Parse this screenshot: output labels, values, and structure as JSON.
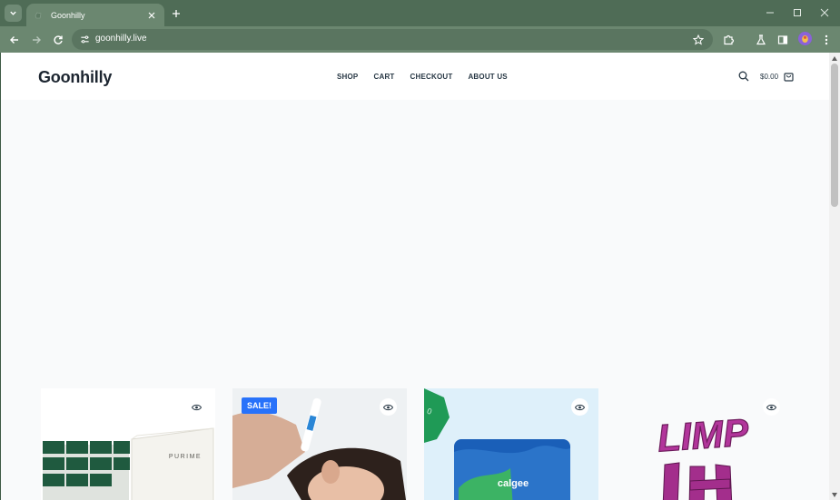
{
  "browser": {
    "tab_title": "Goonhilly",
    "url": "goonhilly.live",
    "icons": [
      "tab-search-icon",
      "favicon",
      "close-icon",
      "plus-icon",
      "minimize-icon",
      "maximize-icon",
      "close-window-icon",
      "back-icon",
      "forward-icon",
      "reload-icon",
      "site-info-icon",
      "star-icon",
      "extensions-icon",
      "labs-icon",
      "side-panel-icon",
      "profile-icon",
      "menu-icon"
    ]
  },
  "site": {
    "logo": "Goonhilly",
    "nav": [
      "SHOP",
      "CART",
      "CHECKOUT",
      "ABOUT US"
    ],
    "cart_total": "$0.00",
    "icons": [
      "search-icon",
      "cart-icon"
    ]
  },
  "products": [
    {
      "image": "purime-product",
      "badge": "",
      "brand_text": "PURIME"
    },
    {
      "image": "ear-cleaning",
      "badge": "SALE!",
      "brand_text": ""
    },
    {
      "image": "calgee-bag",
      "badge": "",
      "brand_text": "calgee"
    },
    {
      "image": "limp-text-art",
      "badge": "",
      "brand_text": "LIMP"
    }
  ],
  "colors": {
    "chrome_frame": "#4f6c56",
    "chrome_toolbar": "#6b8770",
    "sale_badge": "#2872fa",
    "page_bg": "#f9fafb",
    "logo_text": "#1c2530"
  }
}
